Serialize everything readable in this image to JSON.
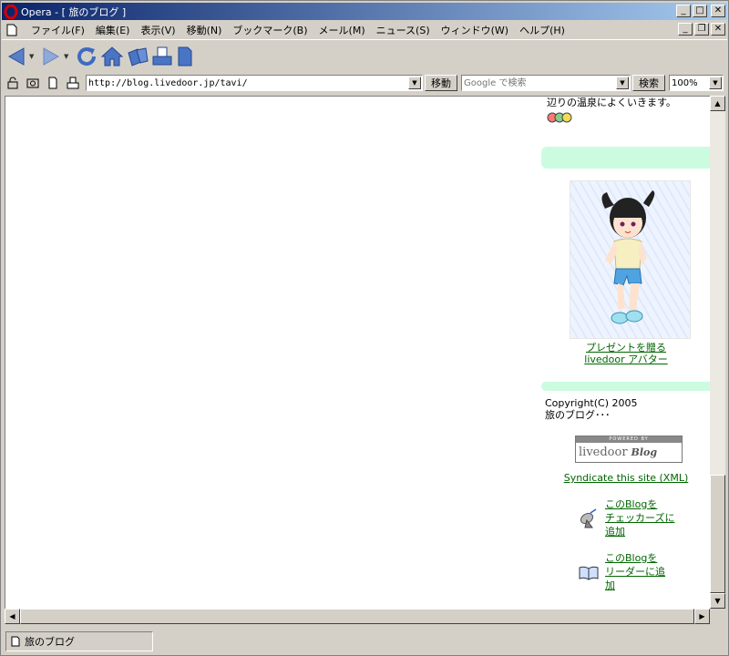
{
  "window": {
    "title": "Opera - [ 旅のブログ ]"
  },
  "menu": {
    "items": [
      "ファイル(F)",
      "編集(E)",
      "表示(V)",
      "移動(N)",
      "ブックマーク(B)",
      "メール(M)",
      "ニュース(S)",
      "ウィンドウ(W)",
      "ヘルプ(H)"
    ]
  },
  "address": {
    "url": "http://blog.livedoor.jp/tavi/",
    "go_label": "移動",
    "search_placeholder": "Google で検索",
    "search_label": "検索",
    "zoom": "100%"
  },
  "page": {
    "intro_text": "辺りの温泉によくいきます。",
    "avatar_link_line1": "プレゼントを贈る",
    "avatar_link_line2": "livedoor アバター",
    "copyright_line1": "Copyright(C) 2005",
    "copyright_line2": "旅のブログ･･･",
    "logo_powered": "POWERED BY",
    "logo_name": "livedoor",
    "logo_blog": "Blog",
    "syndicate": "Syndicate this site (XML)",
    "checkers_line1": "このBlogを",
    "checkers_line2": "チェッカーズに",
    "checkers_line3": "追加",
    "reader_line1": "このBlogを",
    "reader_line2": "リーダーに追",
    "reader_line3": "加"
  },
  "status": {
    "tab_title": "旅のブログ"
  },
  "colors": {
    "title_bar": "#0a246a",
    "link": "#006600",
    "band": "#ccfce0"
  }
}
